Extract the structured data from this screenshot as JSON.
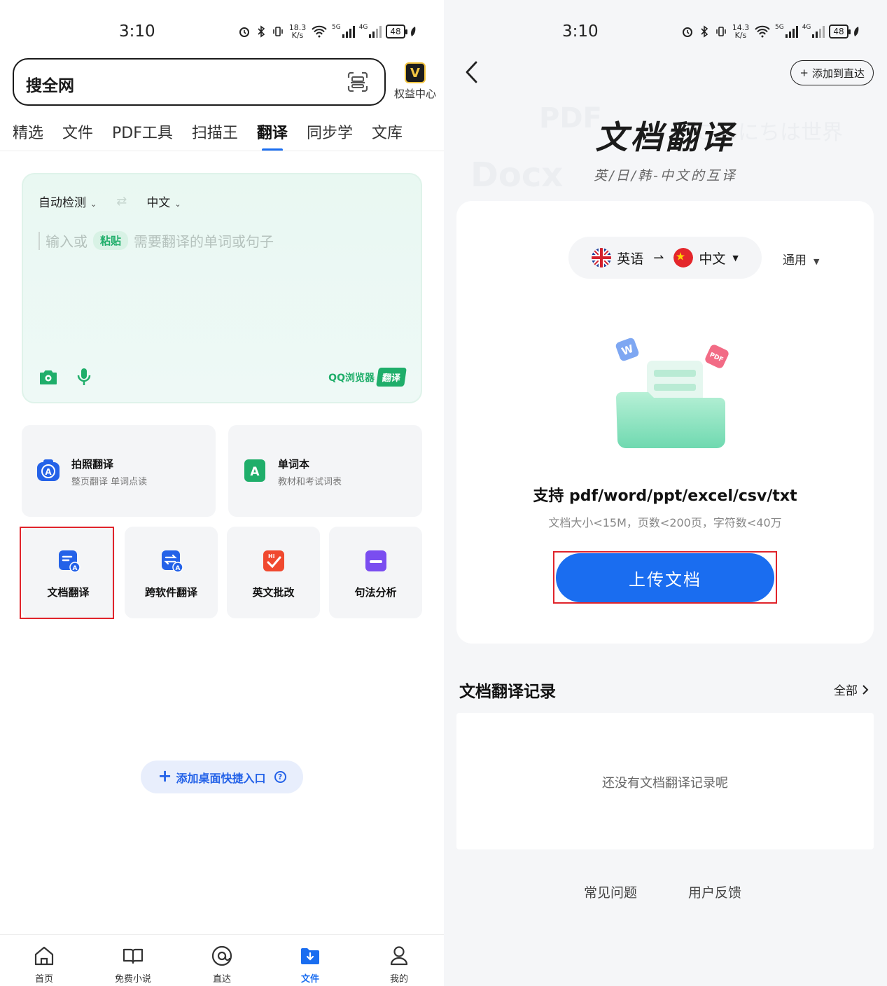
{
  "left": {
    "status": {
      "time": "3:10",
      "net_speed": "18.3",
      "net_unit": "K/s",
      "sig1": "5G",
      "sig2": "4G",
      "battery": "48"
    },
    "search": {
      "text": "搜全网"
    },
    "rights_center": "权益中心",
    "tabs": [
      {
        "label": "精选"
      },
      {
        "label": "文件"
      },
      {
        "label": "PDF工具"
      },
      {
        "label": "扫描王"
      },
      {
        "label": "翻译",
        "active": true
      },
      {
        "label": "同步学"
      },
      {
        "label": "文库"
      }
    ],
    "translator": {
      "source_lang": "自动检测",
      "target_lang": "中文",
      "input_prefix": "输入或",
      "paste_label": "粘贴",
      "input_suffix": "需要翻译的单词或句子",
      "brand": "QQ浏览器",
      "brand_tag": "翻译"
    },
    "features_big": [
      {
        "title": "拍照翻译",
        "subtitle": "整页翻译 单词点读",
        "icon": "camera-translate-icon"
      },
      {
        "title": "单词本",
        "subtitle": "教材和考试词表",
        "icon": "wordbook-icon"
      }
    ],
    "features_small": [
      {
        "label": "文档翻译",
        "icon": "doc-translate-icon",
        "color": "#2462e8"
      },
      {
        "label": "跨软件翻译",
        "icon": "cross-app-translate-icon",
        "color": "#2462e8"
      },
      {
        "label": "英文批改",
        "icon": "essay-correct-icon",
        "color": "#f0492f"
      },
      {
        "label": "句法分析",
        "icon": "syntax-analysis-icon",
        "color": "#7a4df0"
      }
    ],
    "shortcut_label": "添加桌面快捷入口",
    "bottom_nav": [
      {
        "label": "首页",
        "icon": "home-icon"
      },
      {
        "label": "免费小说",
        "icon": "book-icon"
      },
      {
        "label": "直达",
        "icon": "direct-icon"
      },
      {
        "label": "文件",
        "icon": "file-download-icon",
        "active": true
      },
      {
        "label": "我的",
        "icon": "user-icon"
      }
    ]
  },
  "right": {
    "status": {
      "time": "3:10",
      "net_speed": "14.3",
      "net_unit": "K/s",
      "sig1": "5G",
      "sig2": "4G",
      "battery": "48"
    },
    "add_button": "添加到直达",
    "watermarks": [
      "PDF",
      "Docx",
      "こんにちは世界"
    ],
    "title": "文档翻译",
    "subtitle": "英/日/韩-中文的互译",
    "lang_from": "英语",
    "lang_to": "中文",
    "mode": "通用",
    "support_text": "支持 pdf/word/ppt/excel/csv/txt",
    "limits_text": "文档大小<15M，页数<200页，字符数<40万",
    "upload_button": "上传文档",
    "records_title": "文档翻译记录",
    "records_all": "全部",
    "records_empty": "还没有文档翻译记录呢",
    "footer_links": [
      "常见问题",
      "用户反馈"
    ]
  },
  "colors": {
    "accent": "#1a6df0",
    "green": "#1fae6a",
    "highlight": "#e0242b"
  }
}
